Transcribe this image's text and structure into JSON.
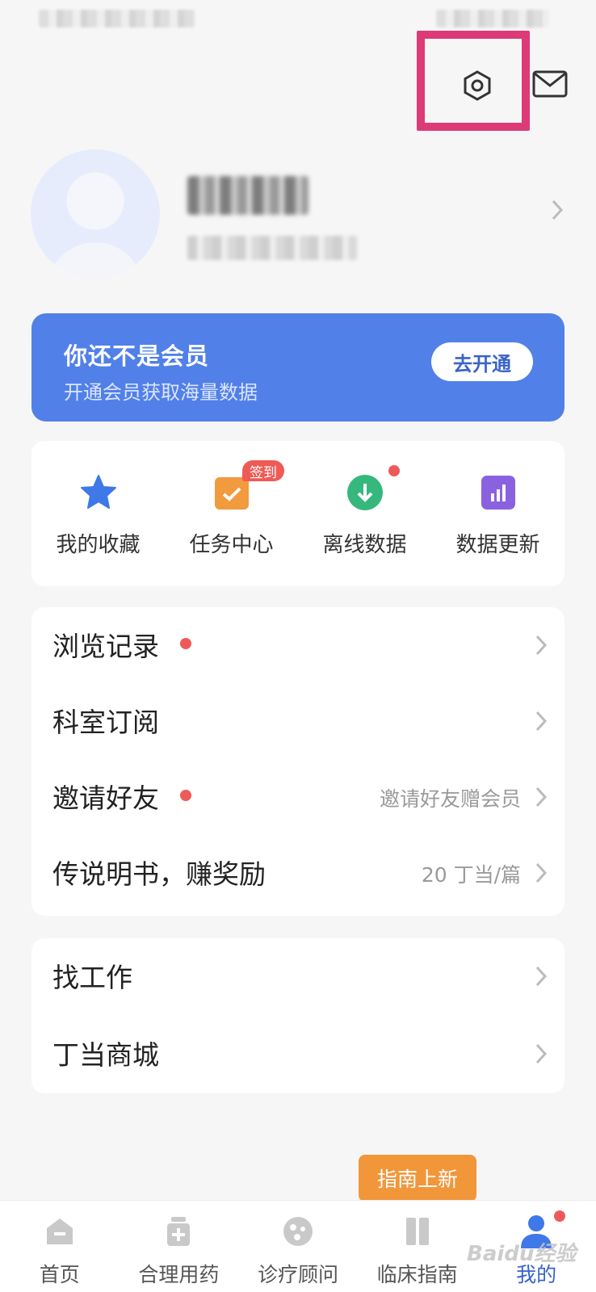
{
  "header": {
    "settings_icon": "gear-hexagon-icon",
    "mail_icon": "mail-icon"
  },
  "member": {
    "title": "你还不是会员",
    "subtitle": "开通会员获取海量数据",
    "button": "去开通"
  },
  "quick": [
    {
      "label": "我的收藏",
      "icon": "star-icon",
      "color": "#3f78e8"
    },
    {
      "label": "任务中心",
      "icon": "task-check-icon",
      "color": "#f29a3e",
      "badge": "签到"
    },
    {
      "label": "离线数据",
      "icon": "download-circle-icon",
      "color": "#36b87c"
    },
    {
      "label": "数据更新",
      "icon": "bar-chart-icon",
      "color": "#8a62e0"
    }
  ],
  "list1": [
    {
      "label": "浏览记录",
      "extra": ""
    },
    {
      "label": "科室订阅",
      "extra": ""
    },
    {
      "label": "邀请好友",
      "extra": "邀请好友赠会员"
    },
    {
      "label": "传说明书，赚奖励",
      "extra": "20 丁当/篇"
    }
  ],
  "list2": [
    {
      "label": "找工作"
    },
    {
      "label": "丁当商城"
    }
  ],
  "tabs": [
    {
      "label": "首页",
      "icon": "home-icon"
    },
    {
      "label": "合理用药",
      "icon": "medicine-icon"
    },
    {
      "label": "诊疗顾问",
      "icon": "consult-icon"
    },
    {
      "label": "临床指南",
      "icon": "book-icon"
    },
    {
      "label": "我的",
      "icon": "user-icon"
    }
  ],
  "tooltip": "指南上新",
  "watermark": "Baidu经验"
}
